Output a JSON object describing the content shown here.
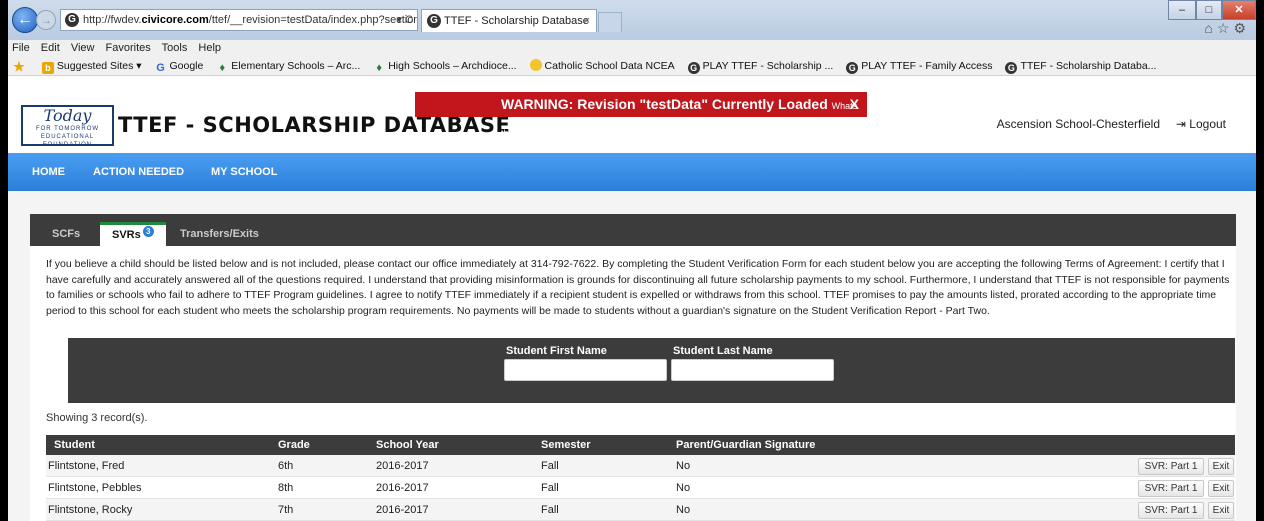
{
  "browser": {
    "url_prefix": "http://fwdev.",
    "url_domain": "civicore.com",
    "url_suffix": "/ttef/__revision=testData/index.php?section=actio",
    "url_tools": "▾ C",
    "tab_title": "TTEF - Scholarship Database",
    "tab_close": "×",
    "menu": [
      "File",
      "Edit",
      "View",
      "Favorites",
      "Tools",
      "Help"
    ],
    "favorites": [
      {
        "icon": "suggested-sites-icon",
        "label": "Suggested Sites ▾"
      },
      {
        "icon": "google-icon",
        "label": "Google"
      },
      {
        "icon": "archdiocese-icon",
        "label": "Elementary Schools – Arc..."
      },
      {
        "icon": "archdiocese-icon",
        "label": "High Schools – Archdioce..."
      },
      {
        "icon": "ncea-icon",
        "label": "Catholic School Data  NCEA"
      },
      {
        "icon": "civicore-icon",
        "label": "PLAY TTEF - Scholarship ..."
      },
      {
        "icon": "civicore-icon",
        "label": "PLAY TTEF - Family Access"
      },
      {
        "icon": "civicore-icon",
        "label": "TTEF - Scholarship Databa..."
      }
    ]
  },
  "header": {
    "logo_script": "Today",
    "logo_sub1": "FOR TOMORROW",
    "logo_sub2": "EDUCATIONAL FOUNDATION",
    "title": "TTEF - SCHOLARSHIP DATABASE",
    "warning": "WARNING: Revision \"testData\" Currently Loaded",
    "warning_link": "Whats this?",
    "warning_close": "X",
    "school": "Ascension School-Chesterfield",
    "logout": "Logout"
  },
  "nav": [
    "HOME",
    "ACTION NEEDED",
    "MY SCHOOL"
  ],
  "tabs": {
    "scfs": "SCFs",
    "svrs": "SVRs",
    "svrs_badge": "3",
    "transfers": "Transfers/Exits"
  },
  "terms": "If you believe a child should be listed below and is not included, please contact our office immediately at 314-792-7622. By completing the Student Verification Form for each student below you are accepting the following Terms of Agreement: I certify that I have carefully and accurately answered all of the questions required. I understand that providing misinformation is grounds for discontinuing all future scholarship payments to my school. Furthermore, I understand that TTEF is not responsible for payments to families or schools who fail to adhere to TTEF Program guidelines. I agree to notify TTEF immediately if a recipient student is expelled or withdraws from this school. TTEF promises to pay the amounts listed, prorated according to the appropriate time period to this school for each student who meets the scholarship program requirements. No payments will be made to students without a guardian's signature on the Student Verification Report - Part Two.",
  "search": {
    "first_label": "Student First Name",
    "last_label": "Student Last Name",
    "first_value": "",
    "last_value": ""
  },
  "records_text": "Showing 3 record(s).",
  "table": {
    "columns": [
      "Student",
      "Grade",
      "School Year",
      "Semester",
      "Parent/Guardian Signature"
    ],
    "rows": [
      {
        "student": "Flintstone, Fred",
        "grade": "6th",
        "year": "2016-2017",
        "semester": "Fall",
        "signature": "No",
        "btn1": "SVR: Part 1",
        "btn2": "Exit"
      },
      {
        "student": "Flintstone, Pebbles",
        "grade": "8th",
        "year": "2016-2017",
        "semester": "Fall",
        "signature": "No",
        "btn1": "SVR: Part 1",
        "btn2": "Exit"
      },
      {
        "student": "Flintstone, Rocky",
        "grade": "7th",
        "year": "2016-2017",
        "semester": "Fall",
        "signature": "No",
        "btn1": "SVR: Part 1",
        "btn2": "Exit"
      }
    ]
  }
}
